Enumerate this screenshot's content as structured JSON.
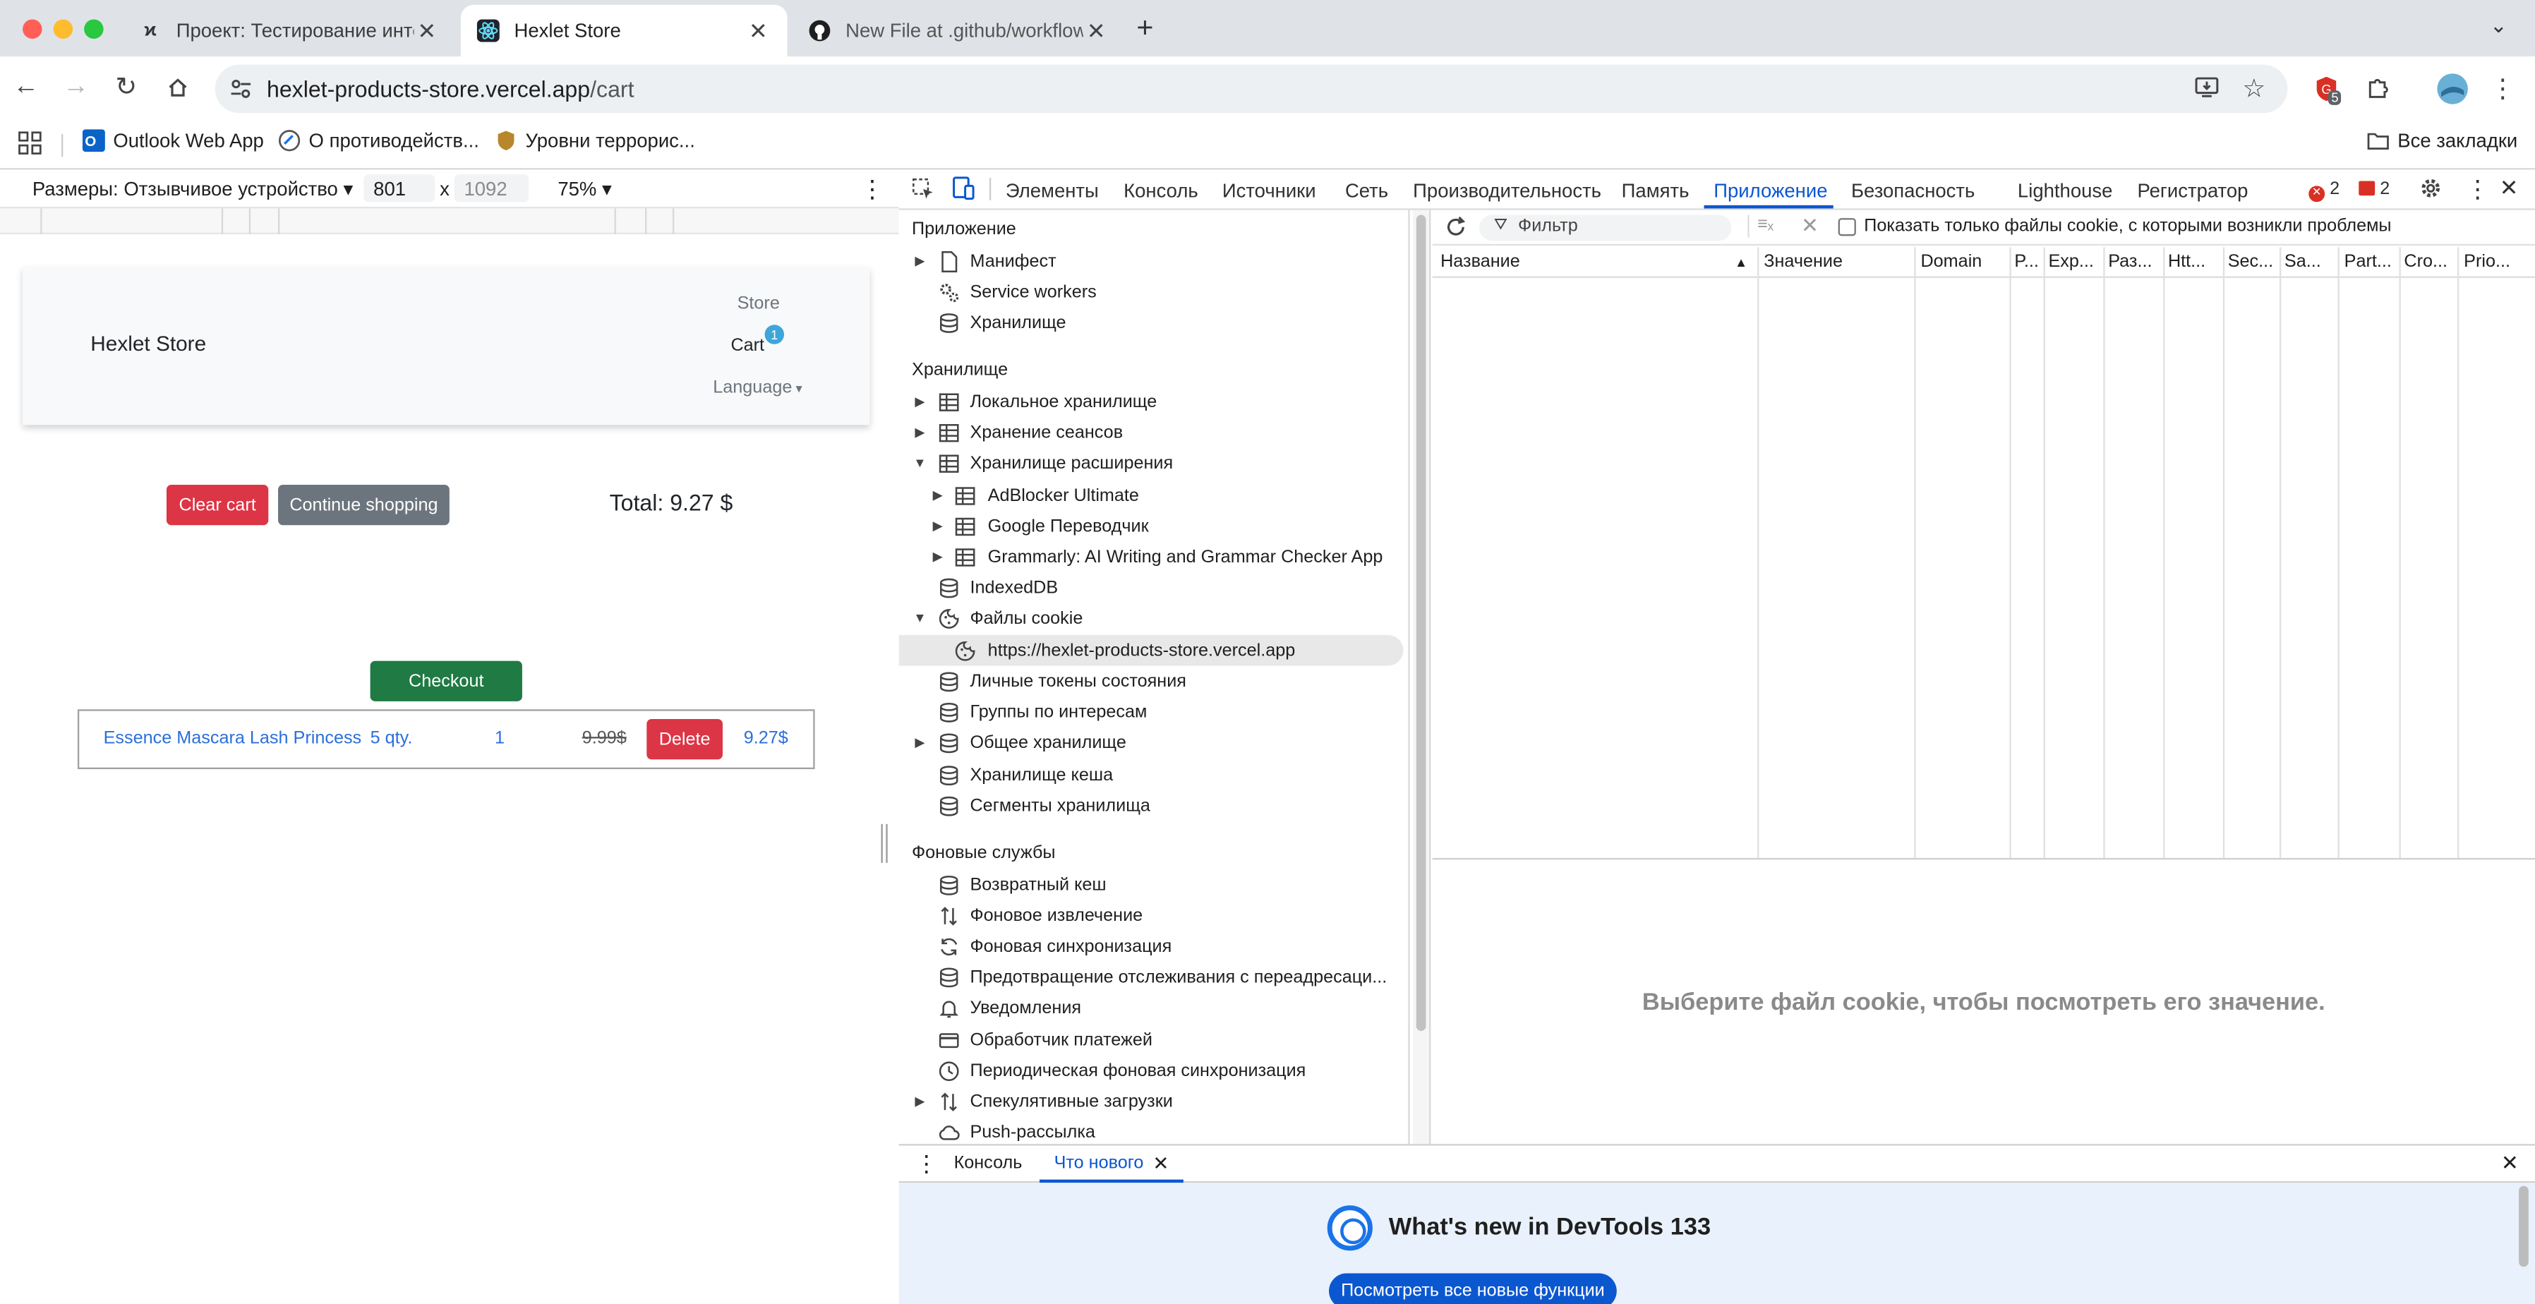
{
  "browser": {
    "tabs": [
      {
        "title": "Проект: Тестирование инте",
        "active": false
      },
      {
        "title": "Hexlet Store",
        "active": true
      },
      {
        "title": "New File at .github/workflows",
        "active": false
      }
    ],
    "url_host": "hexlet-products-store.vercel.app",
    "url_path": "/cart",
    "extension_badge": "5",
    "bookmarks": [
      "Outlook Web App",
      "О противодейств...",
      "Уровни террорис..."
    ],
    "all_bookmarks": "Все закладки"
  },
  "device_toolbar": {
    "dimensions_label": "Размеры: Отзывчивое устройство",
    "width": "801",
    "times": "x",
    "height": "1092",
    "zoom": "75%"
  },
  "store": {
    "brand": "Hexlet Store",
    "nav_store": "Store",
    "nav_cart": "Cart",
    "cart_badge": "1",
    "nav_language": "Language",
    "clear_cart": "Clear cart",
    "continue_shopping": "Continue shopping",
    "total": "Total: 9.27 $",
    "checkout": "Checkout",
    "cart_item": {
      "name": "Essence Mascara Lash Princess",
      "qty": "5 qty.",
      "count": "1",
      "old_price": "9.99$",
      "delete": "Delete",
      "price": "9.27$"
    }
  },
  "devtools": {
    "tabs": [
      "Элементы",
      "Консоль",
      "Источники",
      "Сеть",
      "Производительность",
      "Память",
      "Приложение",
      "Безопасность",
      "Lighthouse",
      "Регистратор"
    ],
    "active_tab": "Приложение",
    "error_count": "2",
    "issue_count": "2",
    "sections": {
      "app": "Приложение",
      "storage": "Хранилище",
      "background": "Фоновые службы"
    },
    "app_items": [
      "Манифест",
      "Service workers",
      "Хранилище"
    ],
    "storage_items": [
      "Локальное хранилище",
      "Хранение сеансов",
      "Хранилище расширения",
      "AdBlocker Ultimate",
      "Google Переводчик",
      "Grammarly: AI Writing and Grammar Checker App",
      "IndexedDB",
      "Файлы cookie",
      "https://hexlet-products-store.vercel.app",
      "Личные токены состояния",
      "Группы по интересам",
      "Общее хранилище",
      "Хранилище кеша",
      "Сегменты хранилища"
    ],
    "background_items": [
      "Возвратный кеш",
      "Фоновое извлечение",
      "Фоновая синхронизация",
      "Предотвращение отслеживания с переадресаци...",
      "Уведомления",
      "Обработчик платежей",
      "Периодическая фоновая синхронизация",
      "Спекулятивные загрузки",
      "Push-рассылка"
    ],
    "filter_placeholder": "Фильтр",
    "only_issues_label": "Показать только файлы cookie, с которыми возникли проблемы",
    "columns": [
      "Название",
      "Значение",
      "Domain",
      "P...",
      "Exp...",
      "Раз...",
      "Htt...",
      "Sec...",
      "Sa...",
      "Part...",
      "Cro...",
      "Prio..."
    ],
    "placeholder": "Выберите файл cookie, чтобы посмотреть его значение.",
    "drawer_tabs": [
      "Консоль",
      "Что нового"
    ],
    "whats_new_title": "What's new in DevTools 133",
    "whats_new_button": "Посмотреть все новые функции"
  }
}
